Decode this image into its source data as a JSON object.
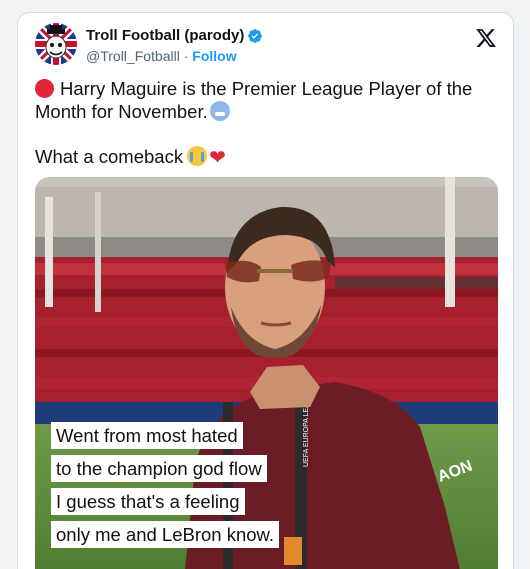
{
  "author": {
    "name": "Troll Football (parody)",
    "handle": "@Troll_Fotballl",
    "separator": "·",
    "follow_label": "Follow"
  },
  "icons": {
    "verified": "verified-badge-icon",
    "platform": "x-logo-icon"
  },
  "tweet": {
    "line1": "Harry Maguire is the Premier League Player of the Month for November.",
    "line2": "What a comeback",
    "heart": "❤"
  },
  "media": {
    "caption_lines": [
      "Went from most hated",
      "to the champion god flow",
      "I guess that's a feeling",
      "only me and LeBron know."
    ],
    "background_text": "UEFA EUROPA LEAGUE",
    "shirt_text": "AON"
  },
  "colors": {
    "accent": "#1d9bf0",
    "text": "#0f1419",
    "muted": "#536471",
    "shirt": "#6b1c24"
  }
}
